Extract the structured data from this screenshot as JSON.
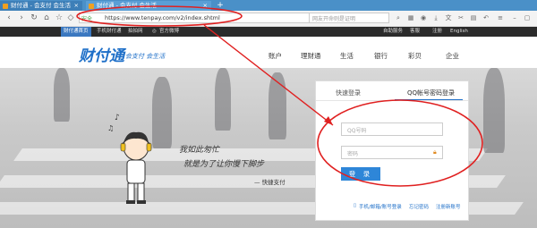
{
  "browser": {
    "tabs": [
      {
        "label": "财付通 - 会支付 会生活"
      },
      {
        "label": "财付通 - 会支付 会生活"
      }
    ],
    "new_tab": "+",
    "address": {
      "secure_label": "安全",
      "url": "https://www.tenpay.com/v2/index.shtml"
    },
    "search_placeholder": "网友开命则是证明"
  },
  "site_topbar": {
    "links": [
      "财付通首页",
      "手机财付通",
      "拍拍网",
      "官方微博"
    ],
    "right_links": [
      "自助服务",
      "客服",
      "注册",
      "English"
    ]
  },
  "header": {
    "logo_text": "财付通",
    "slogan": "会支付 会生活",
    "nav": [
      "账户",
      "理财通",
      "生活",
      "银行",
      "彩贝",
      "企业"
    ]
  },
  "hero": {
    "line1": "我如此匆忙",
    "line2": "就是为了让你慢下脚步",
    "signature": "— 快捷支付"
  },
  "login": {
    "tab_quick": "快速登录",
    "tab_qq": "QQ帐号密码登录",
    "username_placeholder": "QQ号码",
    "password_placeholder": "密码",
    "submit": "登 录",
    "footer_links": [
      "手机/邮箱/账号登录",
      "忘记密码",
      "注册新账号"
    ]
  },
  "colors": {
    "brand_blue": "#1e6fc8",
    "annotation_red": "#e02020"
  }
}
